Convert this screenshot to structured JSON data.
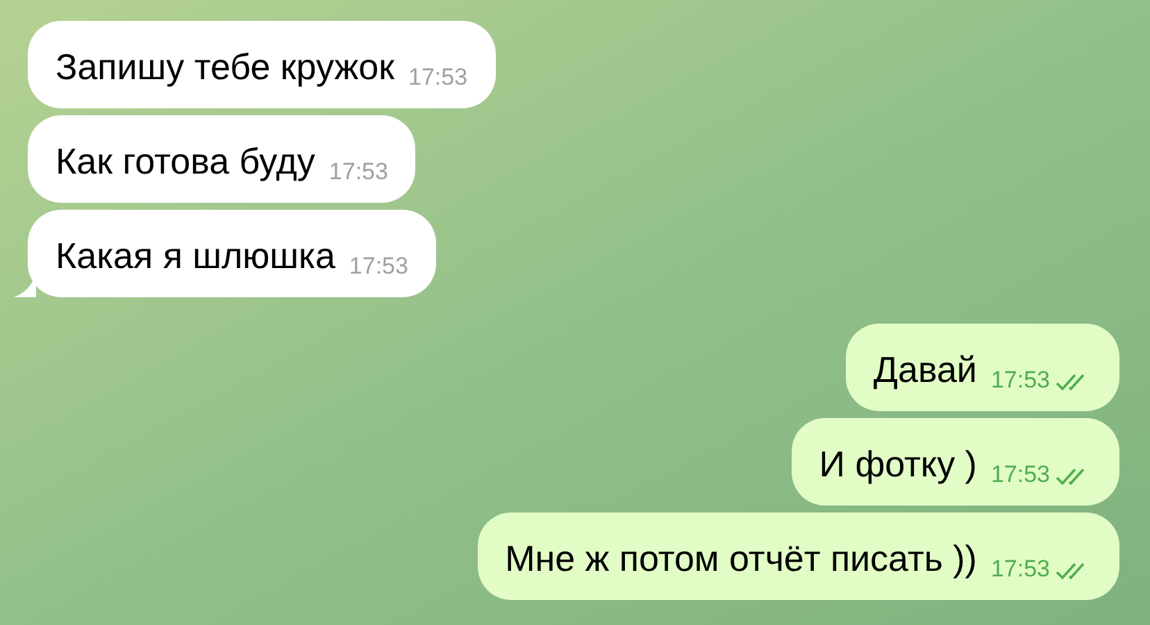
{
  "messages": [
    {
      "kind": "in",
      "text": "Запишу тебе кружок",
      "time": "17:53",
      "tail": false
    },
    {
      "kind": "in",
      "text": "Как готова буду",
      "time": "17:53",
      "tail": false
    },
    {
      "kind": "in",
      "text": "Какая я шлюшка",
      "time": "17:53",
      "tail": true
    },
    {
      "kind": "out",
      "text": "Давай",
      "time": "17:53",
      "read": true
    },
    {
      "kind": "out",
      "text": "И фотку )",
      "time": "17:53",
      "read": true
    },
    {
      "kind": "out",
      "text": "Мне ж потом отчёт писать ))",
      "time": "17:53",
      "read": true
    }
  ]
}
